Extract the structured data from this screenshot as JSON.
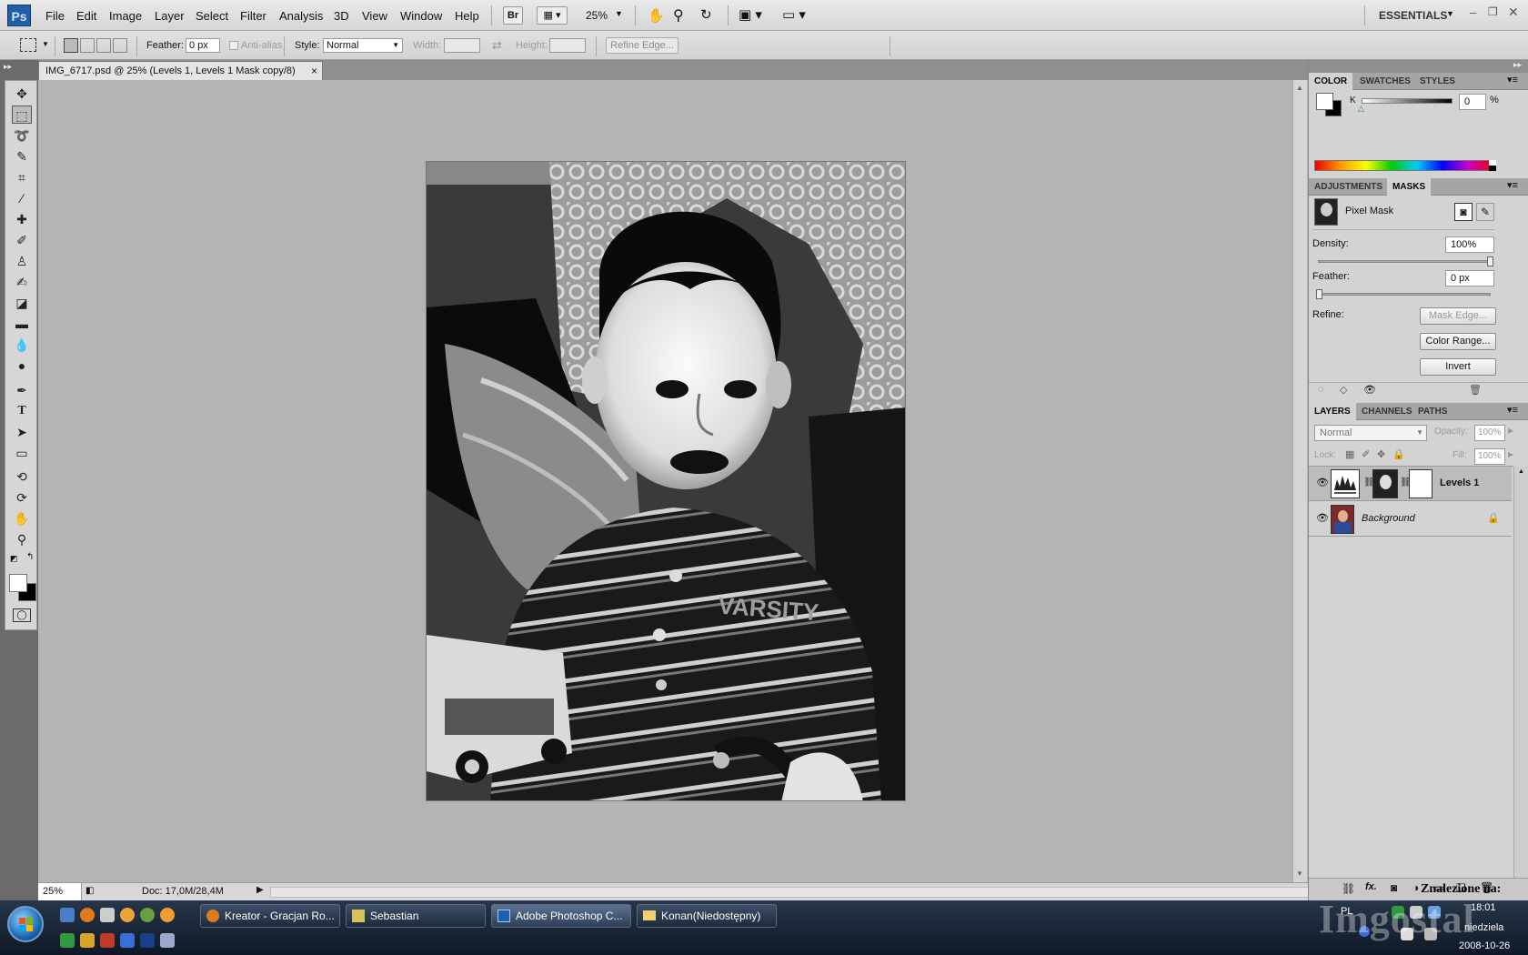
{
  "app": {
    "logo": "Ps"
  },
  "menubar": {
    "items": [
      "File",
      "Edit",
      "Image",
      "Layer",
      "Select",
      "Filter",
      "Analysis",
      "3D",
      "View",
      "Window",
      "Help"
    ],
    "bridge_label": "Br",
    "zoom": "25%",
    "workspace": "ESSENTIALS"
  },
  "options": {
    "feather_label": "Feather:",
    "feather_value": "0 px",
    "antialias_label": "Anti-alias",
    "style_label": "Style:",
    "style_value": "Normal",
    "width_label": "Width:",
    "height_label": "Height:",
    "refine_edge": "Refine Edge..."
  },
  "document": {
    "tab_title": "IMG_6717.psd @ 25% (Levels 1, Levels 1 Mask copy/8)",
    "close": "×",
    "shirt_text": "VARSITY"
  },
  "status": {
    "zoom": "25%",
    "doc": "Doc: 17,0M/28,4M"
  },
  "color_panel": {
    "tabs": [
      "COLOR",
      "SWATCHES",
      "STYLES"
    ],
    "channel": "K",
    "value": "0",
    "unit": "%"
  },
  "masks_panel": {
    "tabs": [
      "ADJUSTMENTS",
      "MASKS"
    ],
    "mask_type": "Pixel Mask",
    "density_label": "Density:",
    "density_value": "100%",
    "feather_label": "Feather:",
    "feather_value": "0 px",
    "refine_label": "Refine:",
    "mask_edge": "Mask Edge...",
    "color_range": "Color Range...",
    "invert": "Invert"
  },
  "layers_panel": {
    "tabs": [
      "LAYERS",
      "CHANNELS",
      "PATHS"
    ],
    "blend_mode": "Normal",
    "opacity_label": "Opacity:",
    "opacity_value": "100%",
    "lock_label": "Lock:",
    "fill_label": "Fill:",
    "fill_value": "100%",
    "layers": [
      {
        "name": "Levels 1"
      },
      {
        "name": "Background"
      }
    ],
    "fx_label": "fx."
  },
  "taskbar": {
    "tasks": [
      "Kreator - Gracjan Ro...",
      "Sebastian",
      "Adobe Photoshop C...",
      "Konan(Niedostępny)"
    ],
    "lang": "PL",
    "time": "18:01",
    "day": "niedziela",
    "date": "2008-10-26"
  },
  "watermark": {
    "caption": "Znalezione na:",
    "brand": "Imgostal"
  }
}
